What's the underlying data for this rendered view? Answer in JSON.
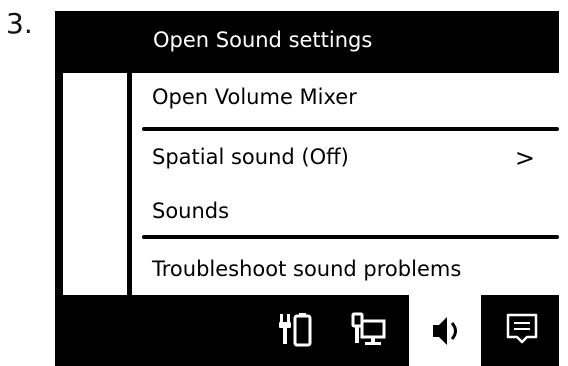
{
  "step": {
    "number": "3."
  },
  "panel": {
    "title": "Open Sound settings"
  },
  "menu": {
    "items": [
      {
        "label": "Open Volume Mixer"
      },
      {
        "label": "Spatial sound (Off)",
        "chevron": ">"
      },
      {
        "label": "Sounds"
      },
      {
        "label": "Troubleshoot sound problems"
      }
    ]
  },
  "taskbar": {
    "icons": [
      {
        "name": "power-battery-icon"
      },
      {
        "name": "network-icon"
      },
      {
        "name": "volume-icon",
        "active": true
      },
      {
        "name": "notifications-icon"
      }
    ]
  },
  "colors": {
    "panel_bg": "#000000",
    "menu_bg": "#ffffff",
    "text_light": "#ffffff",
    "text_dark": "#000000"
  }
}
